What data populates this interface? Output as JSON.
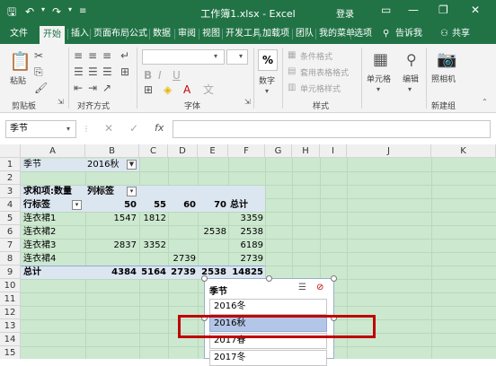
{
  "titlebar": {
    "title": "工作簿1.xlsx - Excel",
    "login": "登录"
  },
  "menu": {
    "tabs": [
      "文件",
      "开始",
      "插入",
      "页面布局",
      "公式",
      "数据",
      "审阅",
      "视图",
      "开发工具",
      "加载项",
      "团队",
      "我的菜单",
      "选项"
    ],
    "tell": "告诉我",
    "share": "共享"
  },
  "ribbon": {
    "clipboard": {
      "paste": "粘贴",
      "label": "剪贴板"
    },
    "align": {
      "label": "对齐方式"
    },
    "font": {
      "label": "字体"
    },
    "number": {
      "label": "数字",
      "percent": "%"
    },
    "styles": {
      "cond": "条件格式",
      "table": "套用表格格式",
      "cell": "单元格样式",
      "label": "样式"
    },
    "cells": {
      "label": "单元格"
    },
    "edit": {
      "label": "编辑"
    },
    "camera": {
      "label": "照相机",
      "group": "新建组"
    }
  },
  "namebox": "季节",
  "fx": "fx",
  "columns": [
    "A",
    "B",
    "C",
    "D",
    "E",
    "F",
    "G",
    "H",
    "I",
    "J",
    "K"
  ],
  "rows": [
    "1",
    "2",
    "3",
    "4",
    "5",
    "6",
    "7",
    "8",
    "9",
    "10",
    "11",
    "12",
    "13",
    "14",
    "15"
  ],
  "pivot": {
    "r1": {
      "a": "季节",
      "b": "2016秋"
    },
    "r3": {
      "a": "求和项:数量",
      "b": "列标签"
    },
    "r4": {
      "a": "行标签",
      "b": "50",
      "c": "55",
      "d": "60",
      "e": "70",
      "f": "总计"
    },
    "r5": {
      "a": "连衣裙1",
      "b": "1547",
      "c": "1812",
      "f": "3359"
    },
    "r6": {
      "a": "连衣裙2",
      "e": "2538",
      "f": "2538"
    },
    "r7": {
      "a": "连衣裙3",
      "b": "2837",
      "c": "3352",
      "f": "6189"
    },
    "r8": {
      "a": "连衣裙4",
      "d": "2739",
      "f": "2739"
    },
    "r9": {
      "a": "总计",
      "b": "4384",
      "c": "5164",
      "d": "2739",
      "e": "2538",
      "f": "14825"
    }
  },
  "slicer": {
    "title": "季节",
    "items": [
      "2016冬",
      "2016秋",
      "2017春",
      "2017冬"
    ],
    "selected": "2016秋"
  },
  "colors": {
    "excel_green": "#217346",
    "grid_bg": "#cce8cf",
    "highlight": "#c00000"
  }
}
